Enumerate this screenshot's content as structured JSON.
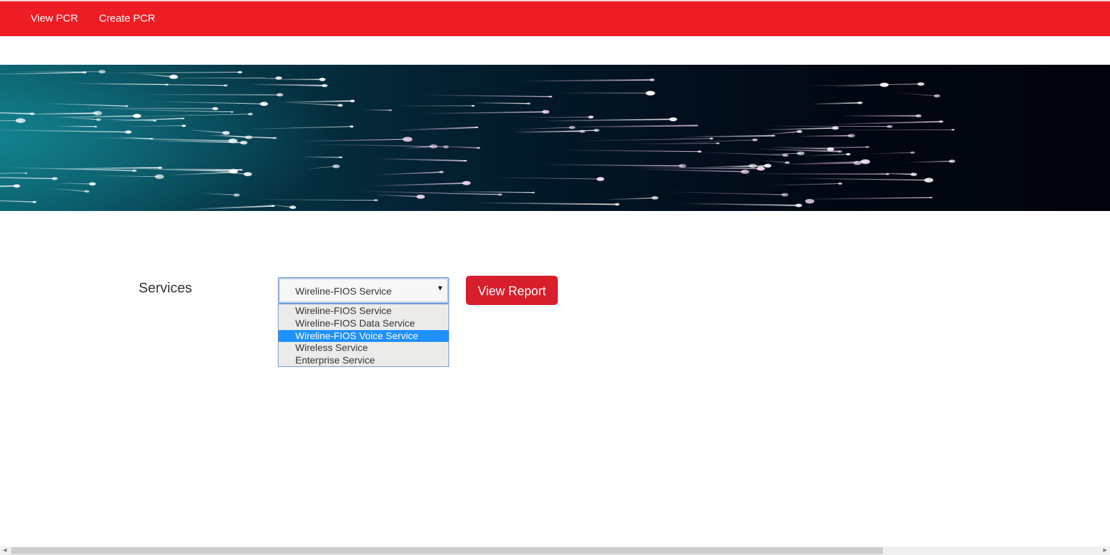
{
  "nav": {
    "view_pcr": "View PCR",
    "create_pcr": "Create PCR"
  },
  "colors": {
    "nav_background": "#ee1c25",
    "button_background": "#d81e2b",
    "selected_option": "#1e90ff"
  },
  "banner": {
    "image": "fiber-optic-light-streaks"
  },
  "form": {
    "services_label": "Services",
    "services_select": {
      "selected_value": "Wireline-FIOS Service",
      "highlighted_option": "Wireline-FIOS Voice Service",
      "options": [
        "Wireline-FIOS Service",
        "Wireline-FIOS Data Service",
        "Wireline-FIOS Voice Service",
        "Wireless Service",
        "Enterprise Service"
      ]
    },
    "view_report_label": "View Report"
  },
  "icons": {
    "select_caret": "▼",
    "scroll_left": "◀",
    "scroll_right": "▶"
  }
}
